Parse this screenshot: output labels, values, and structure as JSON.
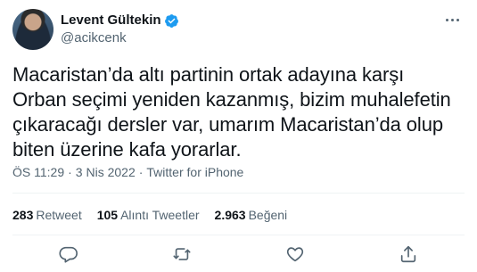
{
  "author": {
    "name": "Levent Gültekin",
    "handle": "@acikcenk",
    "verified": true
  },
  "tweet": {
    "text": "Macaristan’da altı partinin ortak adayına karşı Orban seçimi yeniden kazanmış, bizim muhalefetin çıkaracağı dersler var, umarım Macaristan’da olup biten üzerine kafa yorarlar.",
    "time": "ÖS 11:29",
    "date": "3 Nis 2022",
    "separator": "·",
    "source": "Twitter for iPhone"
  },
  "stats": {
    "retweets_count": "283",
    "retweets_label": "Retweet",
    "quotes_count": "105",
    "quotes_label": "Alıntı Tweetler",
    "likes_count": "2.963",
    "likes_label": "Beğeni"
  },
  "colors": {
    "verified_badge": "#1d9bf0",
    "secondary_text": "#536471",
    "primary_text": "#0f1419"
  },
  "icons": [
    "verified-badge-icon",
    "more-icon",
    "reply-icon",
    "retweet-icon",
    "like-icon",
    "share-icon"
  ]
}
